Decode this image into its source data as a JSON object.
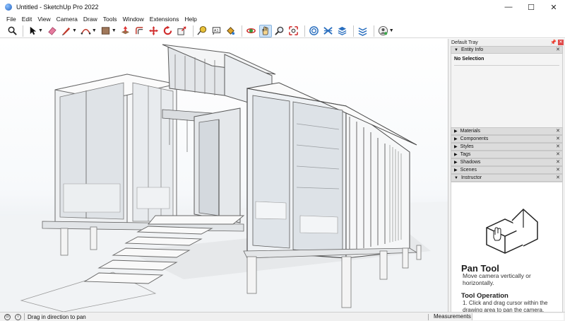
{
  "window": {
    "title": "Untitled - SketchUp Pro 2022",
    "controls": [
      "—",
      "☐",
      "✕"
    ]
  },
  "menu": [
    "File",
    "Edit",
    "View",
    "Camera",
    "Draw",
    "Tools",
    "Window",
    "Extensions",
    "Help"
  ],
  "toolbar": {
    "tools": [
      "search-tool-icon",
      "select-tool-icon",
      "eraser-icon",
      "line-tool-icon",
      "arc-tool-icon",
      "rectangle-tool-icon",
      "push-pull-icon",
      "offset-icon",
      "move-icon",
      "rotate-icon",
      "scale-icon",
      "tape-measure-icon",
      "text-icon",
      "paint-bucket-icon",
      "orbit-icon",
      "pan-icon",
      "zoom-icon",
      "zoom-extents-icon",
      "warehouse-icon",
      "extension-warehouse-icon",
      "layout-icon",
      "extension-manager-icon",
      "profile-icon"
    ]
  },
  "tray": {
    "title": "Default Tray",
    "entity_info": {
      "label": "Entity Info",
      "selection": "No Selection"
    },
    "panels": [
      "Materials",
      "Components",
      "Styles",
      "Tags",
      "Shadows",
      "Scenes",
      "Instructor"
    ],
    "instructor": {
      "heading": "Pan Tool",
      "description": "Move camera vertically or horizontally.",
      "subheading": "Tool Operation",
      "step": "1. Click and drag cursor within the drawing area to pan the camera."
    }
  },
  "status": {
    "message": "Drag in direction to pan",
    "measurements_label": "Measurements",
    "measurements_value": ""
  }
}
